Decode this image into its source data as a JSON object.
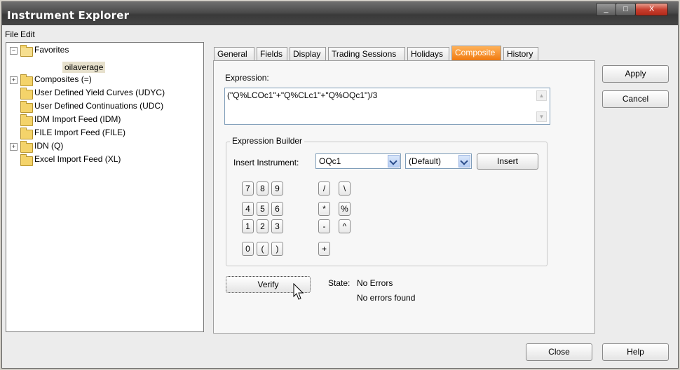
{
  "window": {
    "title": "Instrument Explorer"
  },
  "menu": [
    {
      "label": "File"
    },
    {
      "label": "Edit"
    }
  ],
  "tree": {
    "items": [
      {
        "label": "Favorites"
      },
      {
        "label": "oilaverage"
      },
      {
        "label": "Composites (=)"
      },
      {
        "label": "User Defined Yield Curves (UDYC)"
      },
      {
        "label": "User Defined Continuations (UDC)"
      },
      {
        "label": "IDM Import Feed (IDM)"
      },
      {
        "label": "FILE Import Feed (FILE)"
      },
      {
        "label": "IDN (Q)"
      },
      {
        "label": "Excel Import Feed (XL)"
      }
    ]
  },
  "tabs": [
    {
      "label": "General"
    },
    {
      "label": "Fields"
    },
    {
      "label": "Display"
    },
    {
      "label": "Trading Sessions"
    },
    {
      "label": "Holidays"
    },
    {
      "label": "Composite",
      "active": true
    },
    {
      "label": "History"
    }
  ],
  "composite": {
    "expression_label": "Expression:",
    "expression": "(\"Q%LCOc1\"+\"Q%CLc1\"+\"Q%OQc1\")/3",
    "builder_title": "Expression Builder",
    "insert_label": "Insert Instrument:",
    "instrument_value": "OQc1",
    "field_value": "(Default)",
    "insert_button": "Insert",
    "keys": {
      "k7": "7",
      "k8": "8",
      "k9": "9",
      "kdiv": "/",
      "kback": "\\",
      "k4": "4",
      "k5": "5",
      "k6": "6",
      "kmul": "*",
      "kpct": "%",
      "k1": "1",
      "k2": "2",
      "k3": "3",
      "kminus": "-",
      "kpow": "^",
      "k0": "0",
      "klp": "(",
      "krp": ")",
      "kplus": "+"
    },
    "verify_button": "Verify",
    "state_label": "State:",
    "state_value": "No Errors",
    "state_message": "No errors found"
  },
  "buttons": {
    "apply": "Apply",
    "cancel": "Cancel",
    "close": "Close",
    "help": "Help"
  },
  "window_controls": {
    "minimize": "_",
    "maximize": "□",
    "close": "X"
  },
  "colors": {
    "active_tab": "#f07a10",
    "titlebar": "#4a4a4a",
    "close_button": "#c84030"
  }
}
